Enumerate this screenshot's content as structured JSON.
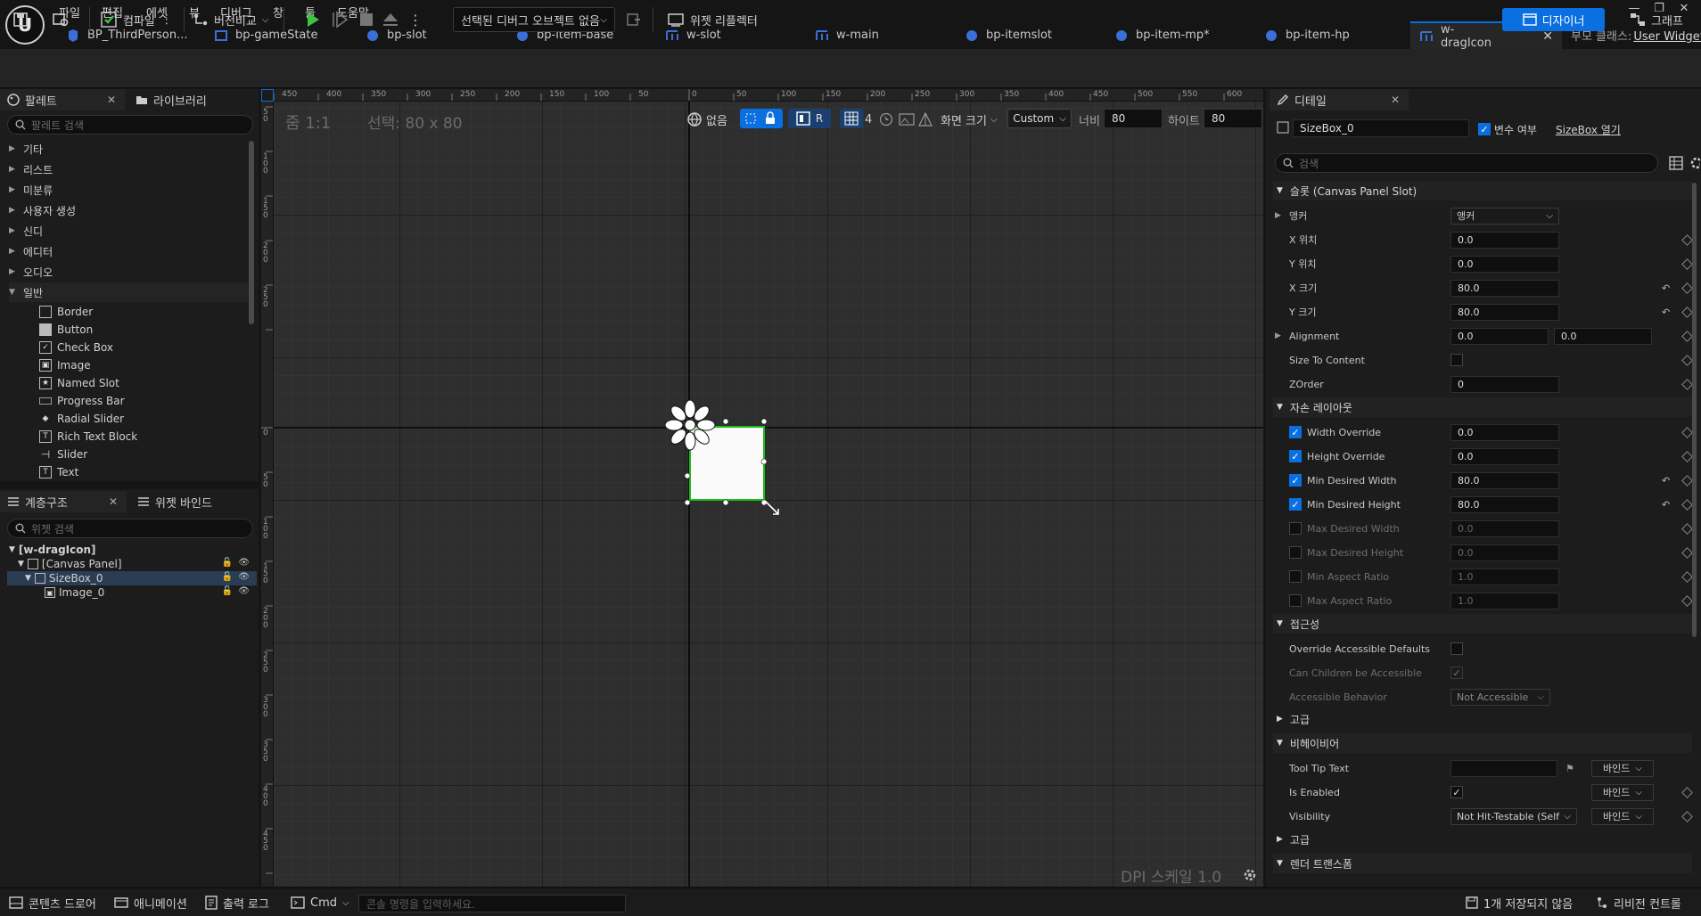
{
  "menu": [
    "파일",
    "편집",
    "에셋",
    "뷰",
    "디버그",
    "창",
    "툴",
    "도움말"
  ],
  "tabs": [
    "BP_ThirdPerson...",
    "bp-gameState",
    "bp-slot",
    "bp-item-base",
    "w-slot",
    "w-main",
    "bp-itemslot",
    "bp-item-mp*",
    "bp-item-hp",
    "w-dragIcon"
  ],
  "parent_class": {
    "label": "부모 클래스:",
    "value": "User Widget"
  },
  "toolbar": {
    "compile": "컴파일",
    "diff": "버전비교",
    "debug_object": "선택된 디버그 오브젝트 없음",
    "widget_reflector": "위젯 리플렉터",
    "designer": "디자이너",
    "graph": "그래프"
  },
  "palette": {
    "tab_label": "팔레트",
    "library_tab": "라이브러리",
    "search_placeholder": "팔레트 검색",
    "categories": [
      "기타",
      "리스트",
      "미분류",
      "사용자 생성",
      "신디",
      "에디터",
      "오디오",
      "일반"
    ],
    "widgets": [
      "Border",
      "Button",
      "Check Box",
      "Image",
      "Named Slot",
      "Progress Bar",
      "Radial Slider",
      "Rich Text Block",
      "Slider",
      "Text"
    ]
  },
  "hierarchy": {
    "tab_label": "계층구조",
    "binding_tab": "위젯 바인드",
    "search_placeholder": "위젯 검색",
    "root": "[w-dragIcon]",
    "canvas": "[Canvas Panel]",
    "sizebox": "SizeBox_0",
    "image": "Image_0"
  },
  "canvas": {
    "zoom": "줌 1:1",
    "selection": "선택: 80 x 80",
    "dpi": "DPI 스케일 1.0",
    "none_label": "없음",
    "r_label": "R",
    "grid_count": "4",
    "screen_size": "화면 크기",
    "size_mode": "Custom",
    "width_label": "너비",
    "width_value": "80",
    "height_label": "하이트",
    "height_value": "80",
    "ruler_top": [
      "450",
      "400",
      "350",
      "300",
      "250",
      "200",
      "150",
      "100",
      "50",
      "0",
      "50",
      "100",
      "150",
      "200",
      "250",
      "300",
      "350",
      "400",
      "450",
      "500",
      "550",
      "600"
    ],
    "ruler_left": [
      "0",
      "50",
      "100",
      "150",
      "200",
      "250",
      "0",
      "50",
      "100",
      "150",
      "200",
      "250",
      "300",
      "350",
      "400",
      "450",
      "500",
      "550",
      "600"
    ]
  },
  "details": {
    "tab_label": "디테일",
    "name": "SizeBox_0",
    "is_variable_label": "변수 여부",
    "open_link": "SizeBox 열기",
    "search_placeholder": "검색",
    "sections": {
      "slot": "슬롯 (Canvas Panel Slot)",
      "child_layout": "자손 레이아웃",
      "accessibility": "접근성",
      "advanced": "고급",
      "behavior": "비헤이비어",
      "advanced2": "고급",
      "render_transform": "렌더 트랜스폼"
    },
    "slot_rows": {
      "anchor_label": "앵커",
      "anchor_value": "앵커",
      "x_pos_label": "X 위치",
      "x_pos": "0.0",
      "y_pos_label": "Y 위치",
      "y_pos": "0.0",
      "x_size_label": "X 크기",
      "x_size": "80.0",
      "y_size_label": "Y 크기",
      "y_size": "80.0",
      "alignment_label": "Alignment",
      "alignment_x": "0.0",
      "alignment_y": "0.0",
      "size_to_content_label": "Size To Content",
      "zorder_label": "ZOrder",
      "zorder": "0"
    },
    "layout_rows": {
      "width_override": "Width Override",
      "width_override_val": "0.0",
      "height_override": "Height Override",
      "height_override_val": "0.0",
      "min_w": "Min Desired Width",
      "min_w_val": "80.0",
      "min_h": "Min Desired Height",
      "min_h_val": "80.0",
      "max_w": "Max Desired Width",
      "max_w_val": "0.0",
      "max_h": "Max Desired Height",
      "max_h_val": "0.0",
      "min_ar": "Min Aspect Ratio",
      "min_ar_val": "1.0",
      "max_ar": "Max Aspect Ratio",
      "max_ar_val": "1.0"
    },
    "access_rows": {
      "override": "Override Accessible Defaults",
      "children": "Can Children be Accessible",
      "behavior": "Accessible Behavior",
      "behavior_value": "Not Accessible"
    },
    "behavior_rows": {
      "tooltip": "Tool Tip Text",
      "enabled": "Is Enabled",
      "visibility": "Visibility",
      "visibility_value": "Not Hit-Testable (Self",
      "bind": "바인드"
    }
  },
  "status": {
    "content_drawer": "콘텐츠 드로어",
    "animation": "애니메이션",
    "output_log": "출력 로그",
    "cmd": "Cmd",
    "console_placeholder": "콘솔 명령을 입력하세요.",
    "unsaved": "1개 저장되지 않음",
    "revision": "리비전 컨트롤"
  },
  "colors": {
    "accent": "#0a6fe0",
    "selection_outline": "#16c016",
    "canvas_bg": "#2e2e2e"
  }
}
